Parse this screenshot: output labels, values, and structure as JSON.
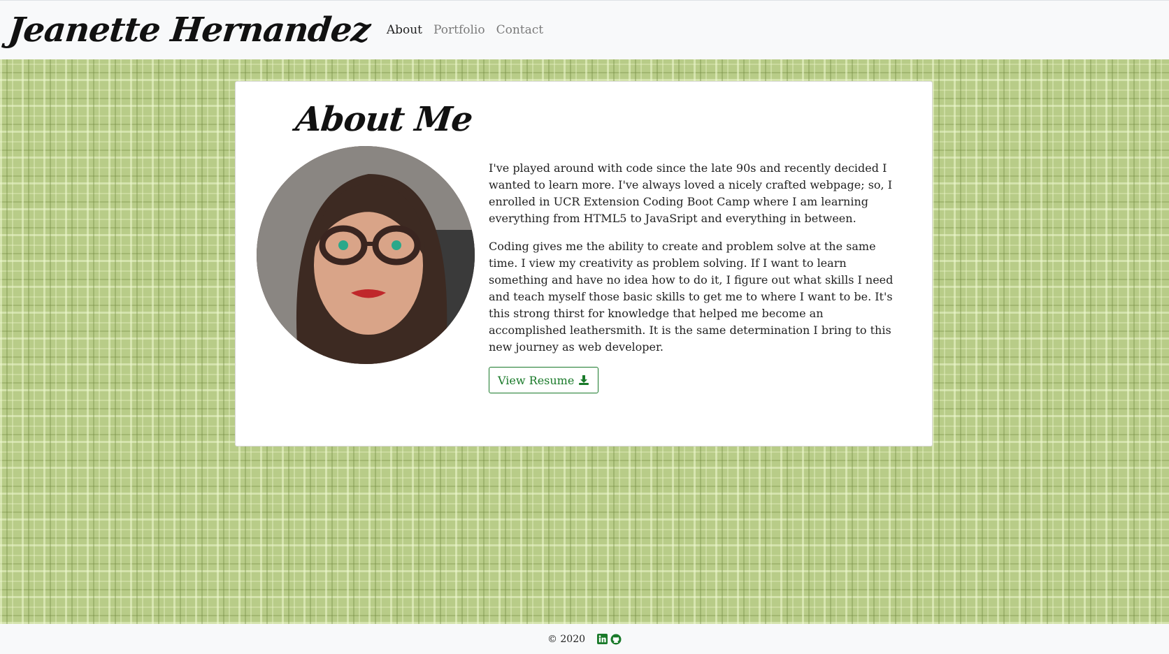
{
  "header": {
    "brand": "Jeanette Hernandez",
    "nav": [
      {
        "label": "About",
        "active": true
      },
      {
        "label": "Portfolio",
        "active": false
      },
      {
        "label": "Contact",
        "active": false
      }
    ]
  },
  "about": {
    "title": "About Me",
    "paragraphs": [
      "I've played around with code since the late 90s and recently decided I wanted to learn more. I've always loved a nicely crafted webpage; so, I enrolled in UCR Extension Coding Boot Camp where I am learning everything from HTML5 to JavaSript and everything in between.",
      "Coding gives me the ability to create and problem solve at the same time. I view my creativity as problem solving. If I want to learn something and have no idea how to do it, I figure out what skills I need and teach myself those basic skills to get me to where I want to be. It's this strong thirst for knowledge that helped me become an accomplished leathersmith. It is the same determination I bring to this new journey as web developer."
    ],
    "resume_button": "View Resume",
    "resume_icon": "download-icon"
  },
  "footer": {
    "copyright": "© 2020",
    "social": [
      {
        "icon": "linkedin-icon"
      },
      {
        "icon": "github-icon"
      }
    ]
  },
  "colors": {
    "accent": "#1a7a2a",
    "background_texture": "#b8cc88",
    "navbar": "#f8f9fa"
  }
}
